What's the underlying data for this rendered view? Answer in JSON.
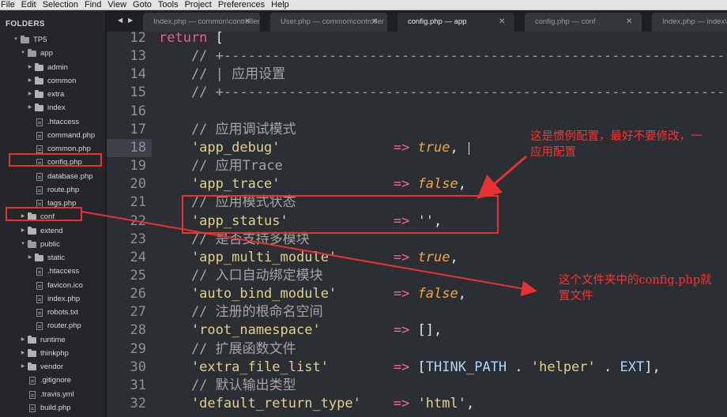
{
  "menubar": {
    "items": [
      "File",
      "Edit",
      "Selection",
      "Find",
      "View",
      "Goto",
      "Tools",
      "Project",
      "Preferences",
      "Help"
    ]
  },
  "sidebar": {
    "title": "FOLDERS",
    "tree": [
      {
        "label": "TP5",
        "kind": "folder",
        "depth": 0,
        "open": true
      },
      {
        "label": "app",
        "kind": "folder",
        "depth": 1,
        "open": true
      },
      {
        "label": "admin",
        "kind": "folder",
        "depth": 2,
        "open": false
      },
      {
        "label": "common",
        "kind": "folder",
        "depth": 2,
        "open": false
      },
      {
        "label": "extra",
        "kind": "folder",
        "depth": 2,
        "open": false
      },
      {
        "label": "index",
        "kind": "folder",
        "depth": 2,
        "open": false
      },
      {
        "label": ".htaccess",
        "kind": "file",
        "depth": 2
      },
      {
        "label": "command.php",
        "kind": "file",
        "depth": 2
      },
      {
        "label": "common.php",
        "kind": "file",
        "depth": 2
      },
      {
        "label": "config.php",
        "kind": "file",
        "depth": 2,
        "selected": true
      },
      {
        "label": "database.php",
        "kind": "file",
        "depth": 2
      },
      {
        "label": "route.php",
        "kind": "file",
        "depth": 2
      },
      {
        "label": "tags.php",
        "kind": "file",
        "depth": 2
      },
      {
        "label": "conf",
        "kind": "folder",
        "depth": 1,
        "open": false,
        "highlighted": true
      },
      {
        "label": "extend",
        "kind": "folder",
        "depth": 1,
        "open": false
      },
      {
        "label": "public",
        "kind": "folder",
        "depth": 1,
        "open": true
      },
      {
        "label": "static",
        "kind": "folder",
        "depth": 2,
        "open": false
      },
      {
        "label": ".htaccess",
        "kind": "file",
        "depth": 2
      },
      {
        "label": "favicon.ico",
        "kind": "file",
        "depth": 2
      },
      {
        "label": "index.php",
        "kind": "file",
        "depth": 2
      },
      {
        "label": "robots.txt",
        "kind": "file",
        "depth": 2
      },
      {
        "label": "router.php",
        "kind": "file",
        "depth": 2
      },
      {
        "label": "runtime",
        "kind": "folder",
        "depth": 1,
        "open": false
      },
      {
        "label": "thinkphp",
        "kind": "folder",
        "depth": 1,
        "open": false
      },
      {
        "label": "vendor",
        "kind": "folder",
        "depth": 1,
        "open": false
      },
      {
        "label": ".gitignore",
        "kind": "file",
        "depth": 1
      },
      {
        "label": ".travis.yml",
        "kind": "file",
        "depth": 1,
        "star": true
      },
      {
        "label": "build.php",
        "kind": "file",
        "depth": 1
      }
    ]
  },
  "tabs": {
    "nav_left": "◀",
    "nav_right": "▶",
    "close_glyph": "✕",
    "items": [
      {
        "title": "Index.php — common\\controller",
        "active": false
      },
      {
        "title": "User.php — common\\controller",
        "active": false
      },
      {
        "title": "config.php — app",
        "active": true
      },
      {
        "title": "config.php — conf",
        "active": false
      },
      {
        "title": "Index.php — index\\controller",
        "active": false
      }
    ]
  },
  "editor": {
    "active_line": 18,
    "lines": [
      {
        "n": "12",
        "tokens": [
          [
            "kw",
            "return"
          ],
          [
            "punct",
            " ["
          ]
        ]
      },
      {
        "n": "13",
        "tokens": [
          [
            "comment",
            "    // +"
          ],
          [
            "dash",
            "--------------------------------------------------------------"
          ]
        ]
      },
      {
        "n": "14",
        "tokens": [
          [
            "comment",
            "    // | 应用设置"
          ]
        ]
      },
      {
        "n": "15",
        "tokens": [
          [
            "comment",
            "    // +"
          ],
          [
            "dash",
            "--------------------------------------------------------------"
          ]
        ]
      },
      {
        "n": "16",
        "tokens": []
      },
      {
        "n": "17",
        "tokens": [
          [
            "comment",
            "    // 应用调试模式"
          ]
        ]
      },
      {
        "n": "18",
        "tokens": [
          [
            "str",
            "    'app_debug'"
          ],
          [
            "punct",
            "              "
          ],
          [
            "arrow-op",
            "=>"
          ],
          [
            "punct",
            " "
          ],
          [
            "bool",
            "true"
          ],
          [
            "punct",
            ","
          ]
        ]
      },
      {
        "n": "19",
        "tokens": [
          [
            "comment",
            "    // 应用Trace"
          ]
        ]
      },
      {
        "n": "20",
        "tokens": [
          [
            "str",
            "    'app_trace'"
          ],
          [
            "punct",
            "              "
          ],
          [
            "arrow-op",
            "=>"
          ],
          [
            "punct",
            " "
          ],
          [
            "bool",
            "false"
          ],
          [
            "punct",
            ","
          ]
        ]
      },
      {
        "n": "21",
        "tokens": [
          [
            "comment",
            "    // 应用模式状态"
          ]
        ]
      },
      {
        "n": "22",
        "tokens": [
          [
            "str",
            "    'app_status'"
          ],
          [
            "punct",
            "             "
          ],
          [
            "arrow-op",
            "=>"
          ],
          [
            "punct",
            " "
          ],
          [
            "str",
            "''"
          ],
          [
            "punct",
            ","
          ]
        ]
      },
      {
        "n": "23",
        "tokens": [
          [
            "comment",
            "    // 是否支持多模块"
          ]
        ]
      },
      {
        "n": "24",
        "tokens": [
          [
            "str",
            "    'app_multi_module'"
          ],
          [
            "punct",
            "       "
          ],
          [
            "arrow-op",
            "=>"
          ],
          [
            "punct",
            " "
          ],
          [
            "bool",
            "true"
          ],
          [
            "punct",
            ","
          ]
        ]
      },
      {
        "n": "25",
        "tokens": [
          [
            "comment",
            "    // 入口自动绑定模块"
          ]
        ]
      },
      {
        "n": "26",
        "tokens": [
          [
            "str",
            "    'auto_bind_module'"
          ],
          [
            "punct",
            "       "
          ],
          [
            "arrow-op",
            "=>"
          ],
          [
            "punct",
            " "
          ],
          [
            "bool",
            "false"
          ],
          [
            "punct",
            ","
          ]
        ]
      },
      {
        "n": "27",
        "tokens": [
          [
            "comment",
            "    // 注册的根命名空间"
          ]
        ]
      },
      {
        "n": "28",
        "tokens": [
          [
            "str",
            "    'root_namespace'"
          ],
          [
            "punct",
            "         "
          ],
          [
            "arrow-op",
            "=>"
          ],
          [
            "punct",
            " [],"
          ]
        ]
      },
      {
        "n": "29",
        "tokens": [
          [
            "comment",
            "    // 扩展函数文件"
          ]
        ]
      },
      {
        "n": "30",
        "tokens": [
          [
            "str",
            "    'extra_file_list'"
          ],
          [
            "punct",
            "        "
          ],
          [
            "arrow-op",
            "=>"
          ],
          [
            "punct",
            " ["
          ],
          [
            "const",
            "THINK_PATH"
          ],
          [
            "punct",
            " . "
          ],
          [
            "str",
            "'helper'"
          ],
          [
            "punct",
            " . "
          ],
          [
            "const",
            "EXT"
          ],
          [
            "punct",
            "],"
          ]
        ]
      },
      {
        "n": "31",
        "tokens": [
          [
            "comment",
            "    // 默认输出类型"
          ]
        ]
      },
      {
        "n": "32",
        "tokens": [
          [
            "str",
            "    'default_return_type'"
          ],
          [
            "punct",
            "    "
          ],
          [
            "arrow-op",
            "=>"
          ],
          [
            "punct",
            " "
          ],
          [
            "str",
            "'html'"
          ],
          [
            "punct",
            ","
          ]
        ]
      }
    ]
  },
  "annotations": {
    "note_app_config": "这是惯例配置，最好不要修改，一\n应用配置",
    "note_conf_folder": "这个文件夹中的config.php就\n置文件",
    "color": "#e73232"
  }
}
